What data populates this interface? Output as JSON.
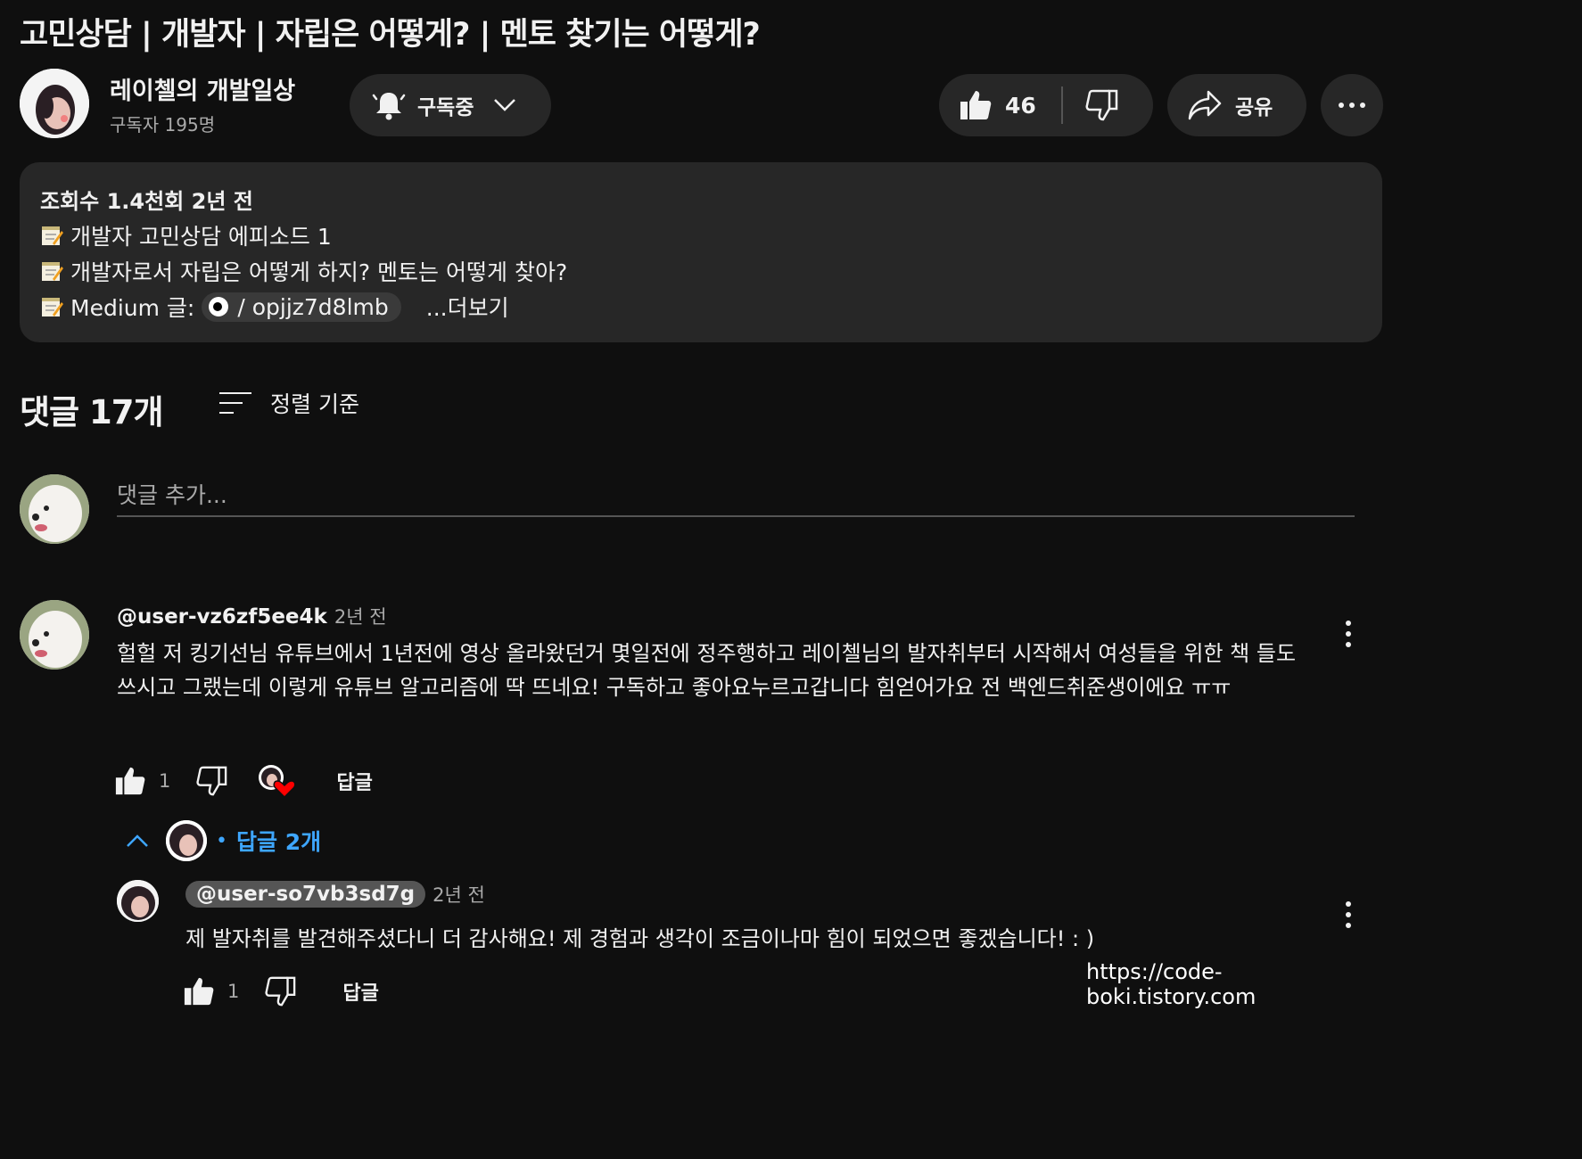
{
  "video": {
    "title": "고민상담 | 개발자 | 자립은 어떻게? | 멘토 찾기는 어떻게?"
  },
  "channel": {
    "name": "레이첼의 개발일상",
    "subscribers": "구독자 195명"
  },
  "actions": {
    "subscribe_label": "구독중",
    "like_count": "46",
    "share_label": "공유"
  },
  "description": {
    "meta": "조회수 1.4천회  2년 전",
    "line1": "개발자 고민상담 에피소드 1",
    "line2": "개발자로서 자립은 어떻게 하지? 멘토는 어떻게 찾아?",
    "line3_prefix": "Medium 글:",
    "link_text": "/ opjjz7d8lmb",
    "more": "...더보기"
  },
  "comments": {
    "header": "댓글 17개",
    "sort_label": "정렬 기준",
    "add_placeholder": "댓글 추가...",
    "items": [
      {
        "author": "@user-vz6zf5ee4k",
        "time": "2년 전",
        "text": "헐헐 저 킹기선님 유튜브에서 1년전에 영상 올라왔던거 몇일전에 정주행하고 레이첼님의 발자취부터 시작해서 여성들을 위한 책 들도 쓰시고 그랬는데 이렇게 유튜브 알고리즘에 딱 뜨네요! 구독하고 좋아요누르고갑니다 힘얻어가요 전 백엔드취준생이에요 ㅠㅠ",
        "likes": "1",
        "reply_label": "답글",
        "replies_toggle": "답글 2개"
      }
    ],
    "replies": [
      {
        "author": "@user-so7vb3sd7g",
        "time": "2년 전",
        "text": "제 발자취를 발견해주셨다니 더 감사해요! 제 경험과 생각이 조금이나마 힘이 되었으면 좋겠습니다! : )",
        "likes": "1",
        "reply_label": "답글"
      }
    ]
  },
  "watermark": "https://code-boki.tistory.com",
  "colors": {
    "background": "#0f0f0f",
    "surface": "#272727",
    "text": "#f1f1f1",
    "secondary": "#aaaaaa",
    "link_blue": "#3ea6ff",
    "heart": "#ff0000"
  },
  "icons": [
    "bell-icon",
    "chevron-down-icon",
    "thumbs-up-icon",
    "thumbs-down-icon",
    "share-icon",
    "more-icon",
    "sort-icon",
    "memo-icon",
    "medium-icon",
    "kebab-icon",
    "heart-icon",
    "chevron-up-icon"
  ]
}
